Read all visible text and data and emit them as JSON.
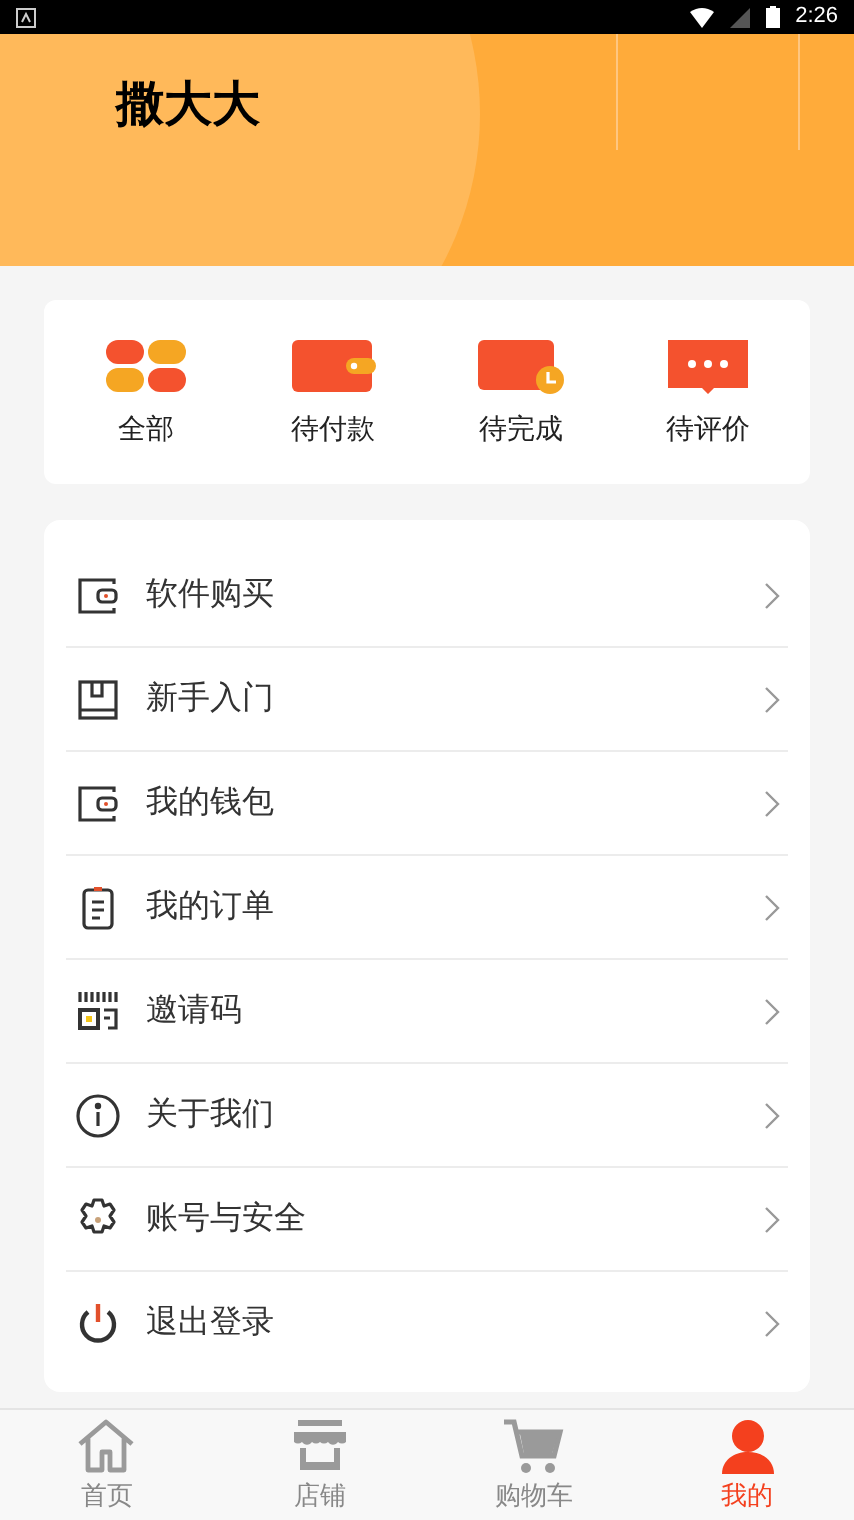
{
  "status_bar": {
    "time": "2:26"
  },
  "header": {
    "title": "撒大大"
  },
  "orders": [
    {
      "kind": "all",
      "label": "全部"
    },
    {
      "kind": "pay",
      "label": "待付款"
    },
    {
      "kind": "done",
      "label": "待完成"
    },
    {
      "kind": "review",
      "label": "待评价"
    }
  ],
  "menu": [
    {
      "kind": "wallet",
      "label": "软件购买"
    },
    {
      "kind": "book",
      "label": "新手入门"
    },
    {
      "kind": "wallet",
      "label": "我的钱包"
    },
    {
      "kind": "clipboard",
      "label": "我的订单"
    },
    {
      "kind": "code",
      "label": "邀请码"
    },
    {
      "kind": "info",
      "label": "关于我们"
    },
    {
      "kind": "gear",
      "label": "账号与安全"
    },
    {
      "kind": "power",
      "label": "退出登录"
    }
  ],
  "nav": [
    {
      "kind": "home",
      "label": "首页",
      "selected": false
    },
    {
      "kind": "store",
      "label": "店铺",
      "selected": false
    },
    {
      "kind": "cart",
      "label": "购物车",
      "selected": false
    },
    {
      "kind": "user",
      "label": "我的",
      "selected": true
    }
  ]
}
